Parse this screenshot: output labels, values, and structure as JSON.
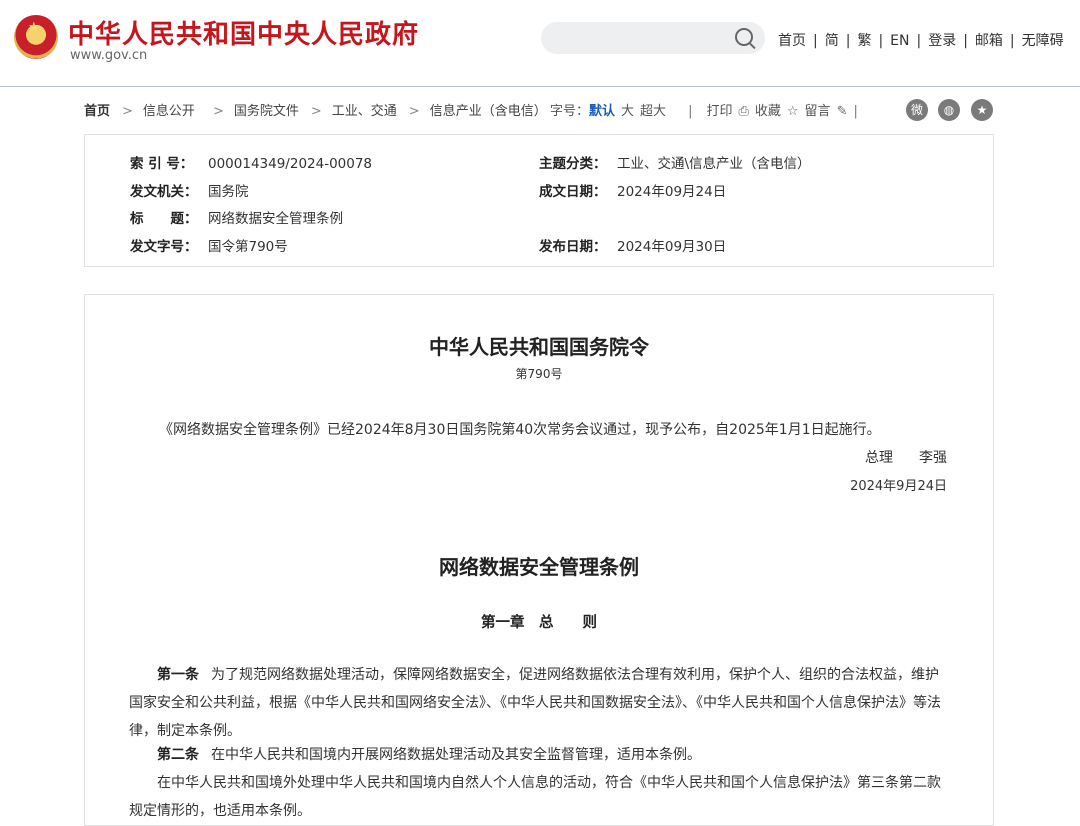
{
  "header": {
    "site_title": "中华人民共和国中央人民政府",
    "site_domain": "www.gov.cn",
    "search_placeholder": "",
    "nav": [
      "首页",
      "简",
      "繁",
      "EN",
      "登录",
      "邮箱",
      "无障碍"
    ]
  },
  "breadcrumb": [
    "首页",
    "信息公开",
    "国务院文件",
    "工业、交通",
    "信息产业（含电信）"
  ],
  "toolbar": {
    "font_label": "字号：",
    "font_default": "默认",
    "font_large": "大",
    "font_xlarge": "超大",
    "print": "打印",
    "favorite": "收藏",
    "comment": "留言"
  },
  "social": {
    "weibo_icon": "weibo-icon",
    "wechat_icon": "wechat-icon",
    "favorite_icon": "star-icon"
  },
  "meta": {
    "index_no_label": "索 引 号：",
    "index_no": "000014349/2024-00078",
    "category_label": "主题分类：",
    "category": "工业、交通\\信息产业（含电信）",
    "issuer_label": "发文机关：",
    "issuer": "国务院",
    "written_date_label": "成文日期：",
    "written_date": "2024年09月24日",
    "title_label": "标　　题：",
    "title": "网络数据安全管理条例",
    "doc_no_label": "发文字号：",
    "doc_no": "国令第790号",
    "publish_date_label": "发布日期：",
    "publish_date": "2024年09月30日"
  },
  "article": {
    "decree_title": "中华人民共和国国务院令",
    "decree_no": "第790号",
    "promulgation": "《网络数据安全管理条例》已经2024年8月30日国务院第40次常务会议通过，现予公布，自2025年1月1日起施行。",
    "signer_title": "总理",
    "signer_name": "李强",
    "sign_date": "2024年9月24日",
    "regulation_title": "网络数据安全管理条例",
    "chapter": "第一章　总　　则",
    "art1_label": "第一条",
    "art1_text": "为了规范网络数据处理活动，保障网络数据安全，促进网络数据依法合理有效利用，保护个人、组织的合法权益，维护国家安全和公共利益，根据《中华人民共和国网络安全法》、《中华人民共和国数据安全法》、《中华人民共和国个人信息保护法》等法律，制定本条例。",
    "art2_label": "第二条",
    "art2_text": "在中华人民共和国境内开展网络数据处理活动及其安全监督管理，适用本条例。",
    "art2_para2": "在中华人民共和国境外处理中华人民共和国境内自然人个人信息的活动，符合《中华人民共和国个人信息保护法》第三条第二款规定情形的，也适用本条例。"
  }
}
